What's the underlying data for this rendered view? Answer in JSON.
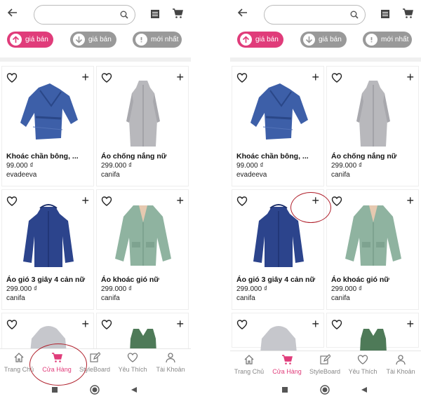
{
  "screens": [
    {
      "sort_buttons": [
        {
          "label": "giá bán",
          "direction": "up"
        },
        {
          "label": "giá bán",
          "direction": "down"
        },
        {
          "label": "mới nhất",
          "direction": "new"
        }
      ],
      "products": [
        {
          "name": "Khoác chần bông, ...",
          "price": "99.000 ₫",
          "brand": "evadeeva",
          "image": "blue-quilted-jacket"
        },
        {
          "name": "Áo chống nắng nữ",
          "price": "299.000 ₫",
          "brand": "canifa",
          "image": "grey-sun-protection-coat"
        },
        {
          "name": "Áo gió 3 giây 4 cản nữ",
          "price": "299.000 ₫",
          "brand": "canifa",
          "image": "navy-windbreaker"
        },
        {
          "name": "Áo khoác gió nữ",
          "price": "299.000 ₫",
          "brand": "canifa",
          "image": "sage-green-jacket"
        }
      ],
      "nav": [
        "Trang Chủ",
        "Cửa Hàng",
        "StyleBoard",
        "Yêu Thích",
        "Tài Khoản"
      ]
    },
    {
      "sort_buttons": [
        {
          "label": "giá bán",
          "direction": "up"
        },
        {
          "label": "giá bán",
          "direction": "down"
        },
        {
          "label": "mới nhất",
          "direction": "new"
        }
      ],
      "products": [
        {
          "name": "Khoác chần bông, ...",
          "price": "99.000 ₫",
          "brand": "evadeeva",
          "image": "blue-quilted-jacket"
        },
        {
          "name": "Áo chống nắng nữ",
          "price": "299.000 ₫",
          "brand": "canifa",
          "image": "grey-sun-protection-coat"
        },
        {
          "name": "Áo gió 3 giây 4 cản nữ",
          "price": "299.000 ₫",
          "brand": "canifa",
          "image": "navy-windbreaker"
        },
        {
          "name": "Áo khoác gió nữ",
          "price": "299.000 ₫",
          "brand": "canifa",
          "image": "sage-green-jacket"
        }
      ],
      "nav": [
        "Trang Chủ",
        "Cửa Hàng",
        "StyleBoard",
        "Yêu Thích",
        "Tài Khoản"
      ]
    }
  ],
  "colors": {
    "accent": "#e03c7a",
    "inactive_pill": "#999999",
    "annotation": "#b0202c"
  },
  "icons": [
    "back-arrow-icon",
    "search-icon",
    "list-icon",
    "cart-icon",
    "heart-icon",
    "plus-icon",
    "home-icon",
    "store-cart-icon",
    "edit-icon",
    "user-icon"
  ],
  "annotations": [
    "circle-around-store-tab",
    "circle-around-add-button"
  ]
}
